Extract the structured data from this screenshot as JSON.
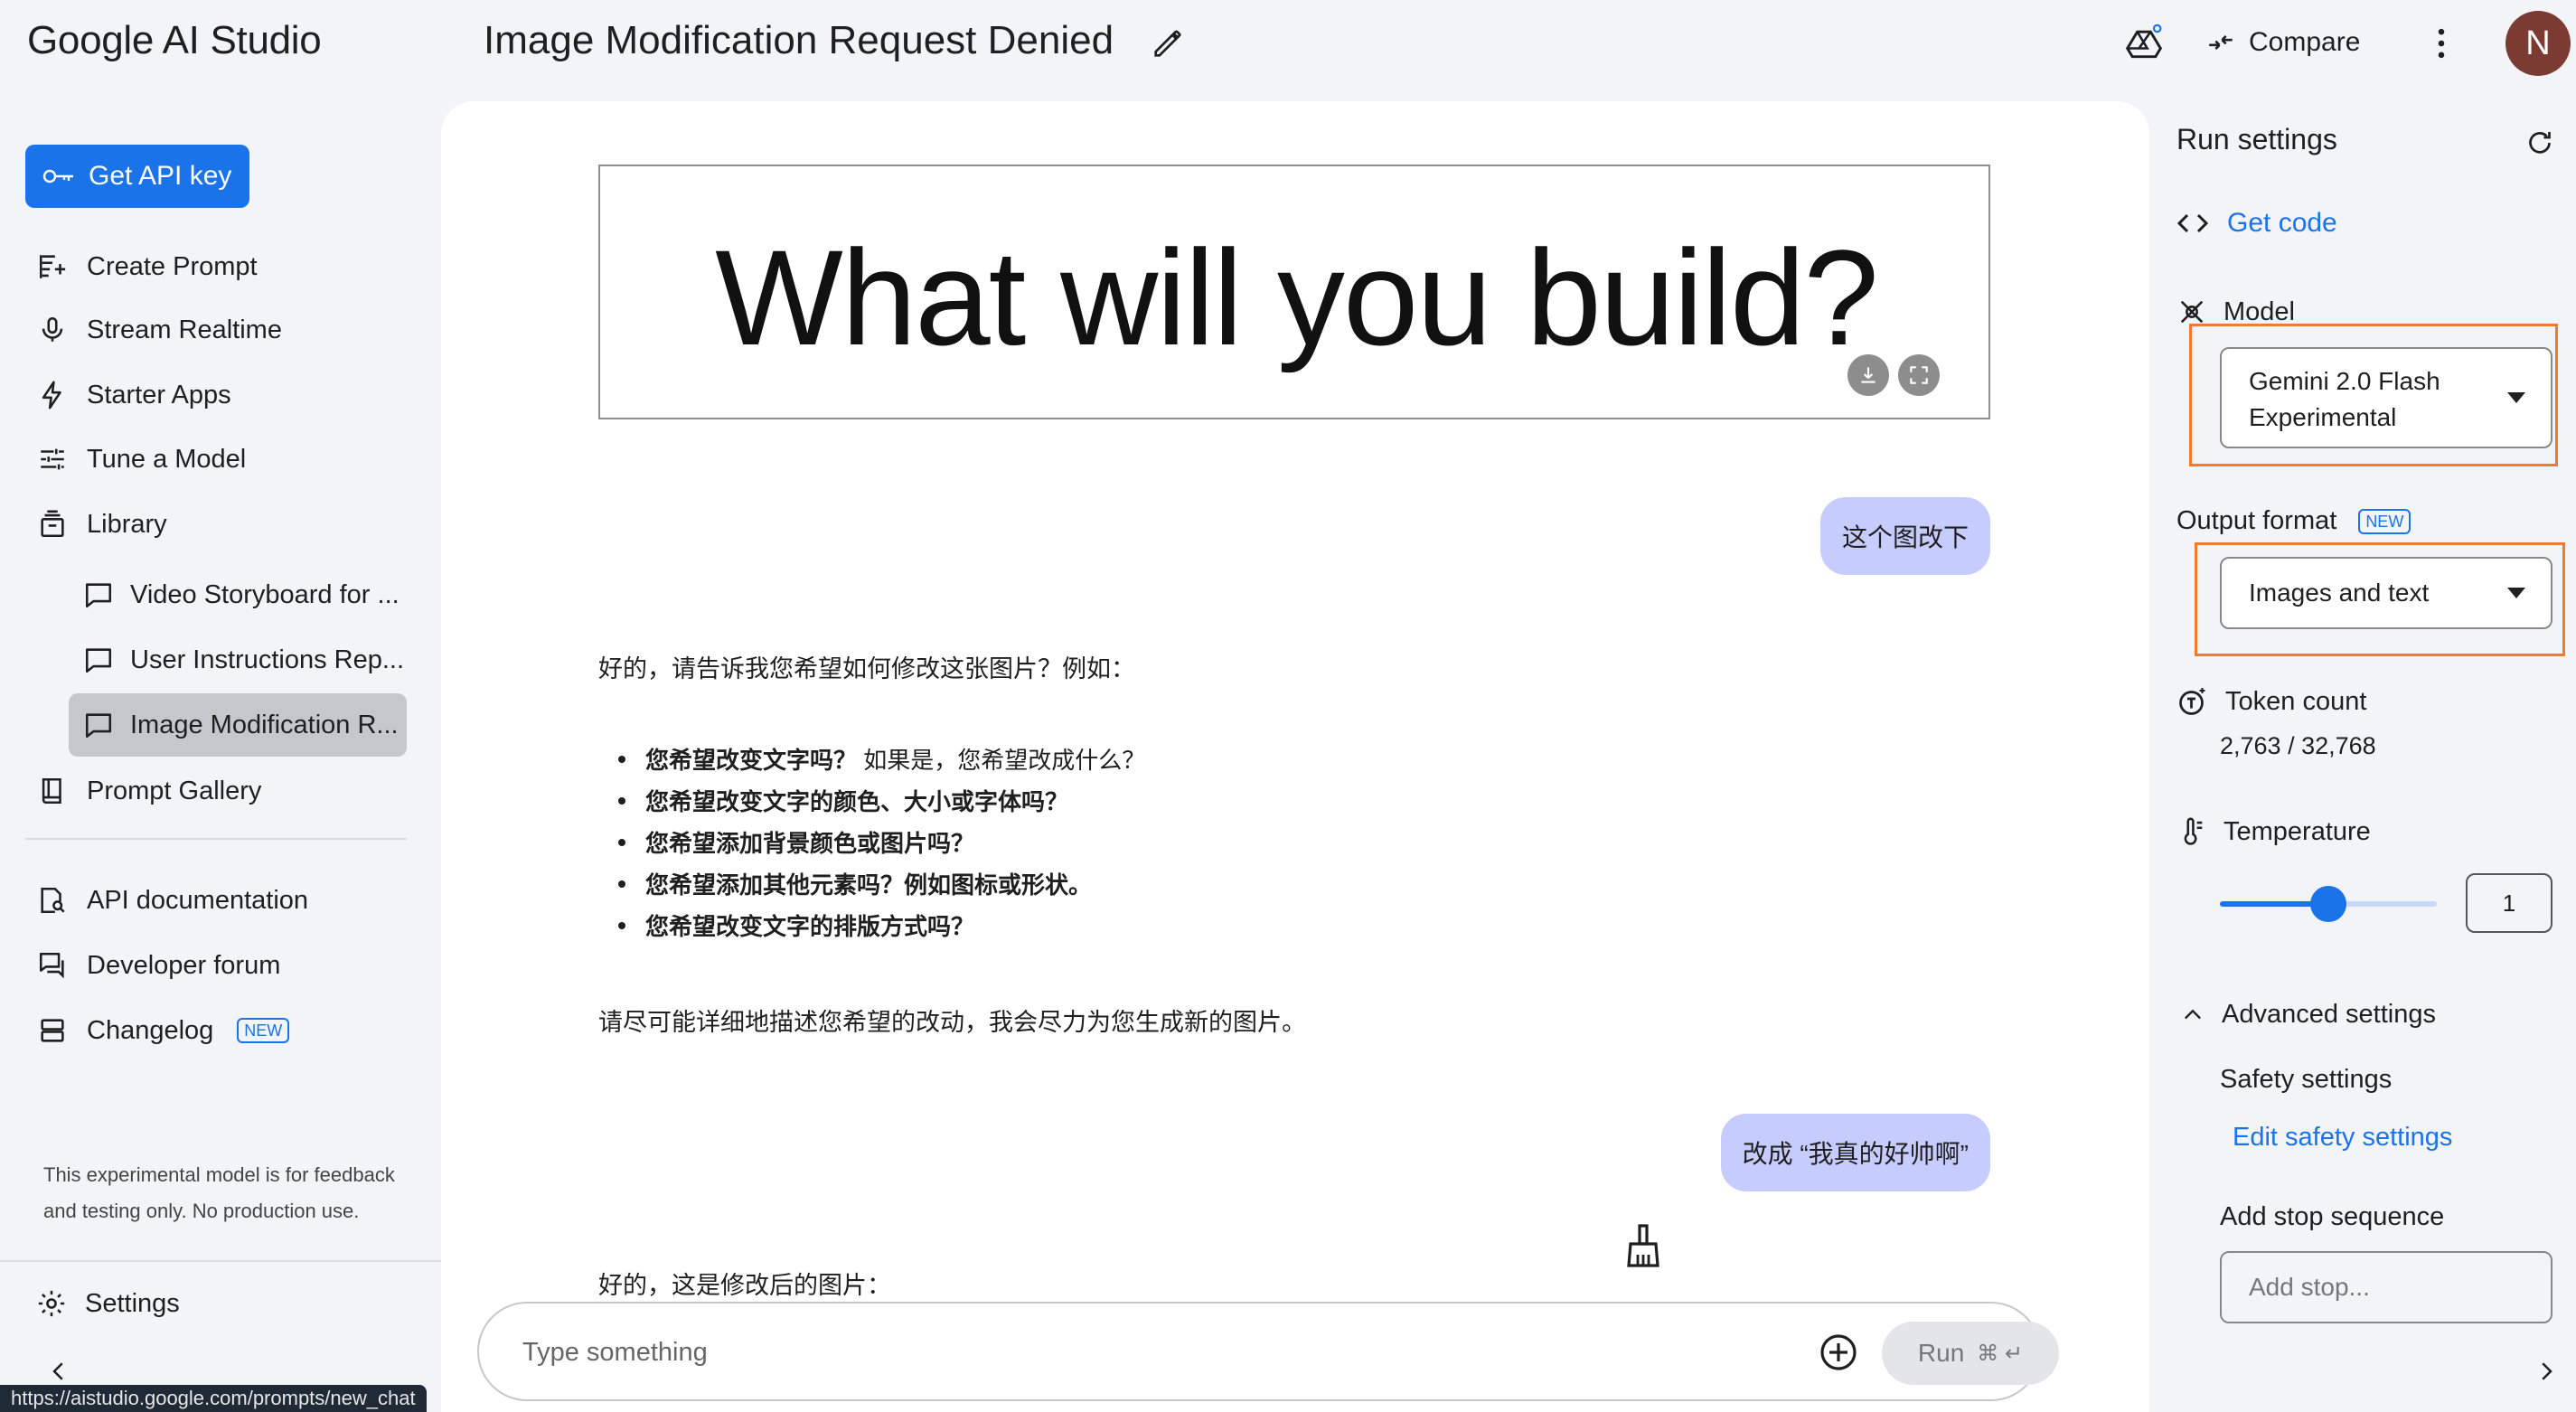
{
  "app": {
    "brand": "Google AI Studio",
    "chat_title": "Image Modification Request Denied",
    "compare_label": "Compare",
    "avatar_initial": "N"
  },
  "sidebar": {
    "api_key_label": "Get API key",
    "nav": [
      {
        "label": "Create Prompt",
        "icon": "create-prompt-icon"
      },
      {
        "label": "Stream Realtime",
        "icon": "microphone-icon"
      },
      {
        "label": "Starter Apps",
        "icon": "bolt-icon"
      },
      {
        "label": "Tune a Model",
        "icon": "tune-icon"
      },
      {
        "label": "Library",
        "icon": "library-icon"
      }
    ],
    "library_items": [
      {
        "label": "Video Storyboard for ..."
      },
      {
        "label": "User Instructions Rep..."
      },
      {
        "label": "Image Modification R..."
      }
    ],
    "gallery_label": "Prompt Gallery",
    "resources": [
      {
        "label": "API documentation"
      },
      {
        "label": "Developer forum"
      },
      {
        "label": "Changelog",
        "badge": "NEW"
      }
    ],
    "disclaimer": "This experimental model is for feedback and testing only. No production use.",
    "settings_label": "Settings",
    "status_url": "https://aistudio.google.com/prompts/new_chat"
  },
  "chat": {
    "image_text": "What will you build?",
    "user_msg_1": "这个图改下",
    "model_msg_1_intro": "好的，请告诉我您希望如何修改这张图片？例如：",
    "bullets": [
      {
        "bold": "您希望改变文字吗？",
        "rest": " 如果是，您希望改成什么？"
      },
      {
        "bold": "您希望改变文字的颜色、大小或字体吗？",
        "rest": ""
      },
      {
        "bold": "您希望添加背景颜色或图片吗？",
        "rest": ""
      },
      {
        "bold": "您希望添加其他元素吗？例如图标或形状。",
        "rest": ""
      },
      {
        "bold": "您希望改变文字的排版方式吗？",
        "rest": ""
      }
    ],
    "model_msg_1_outro": "请尽可能详细地描述您希望的改动，我会尽力为您生成新的图片。",
    "user_msg_2": "改成 “我真的好帅啊”",
    "model_msg_2": "好的，这是修改后的图片：",
    "input_placeholder": "Type something",
    "run_label": "Run",
    "run_shortcut": "⌘ ↵"
  },
  "run_settings": {
    "title": "Run settings",
    "get_code": "Get code",
    "model_label": "Model",
    "model_value_line1": "Gemini 2.0 Flash",
    "model_value_line2": "Experimental",
    "output_format_label": "Output format",
    "output_format_badge": "NEW",
    "output_format_value": "Images and text",
    "token_count_label": "Token count",
    "token_count_value": "2,763 / 32,768",
    "temperature_label": "Temperature",
    "temperature_value": "1",
    "temperature_fraction": 0.5,
    "advanced_label": "Advanced settings",
    "safety_label": "Safety settings",
    "edit_safety": "Edit safety settings",
    "stop_seq_label": "Add stop sequence",
    "stop_placeholder": "Add stop..."
  },
  "colors": {
    "accent": "#1a73e8",
    "user_bubble": "#c7ccff",
    "highlight": "#f37a2a",
    "avatar": "#7b3b32"
  }
}
